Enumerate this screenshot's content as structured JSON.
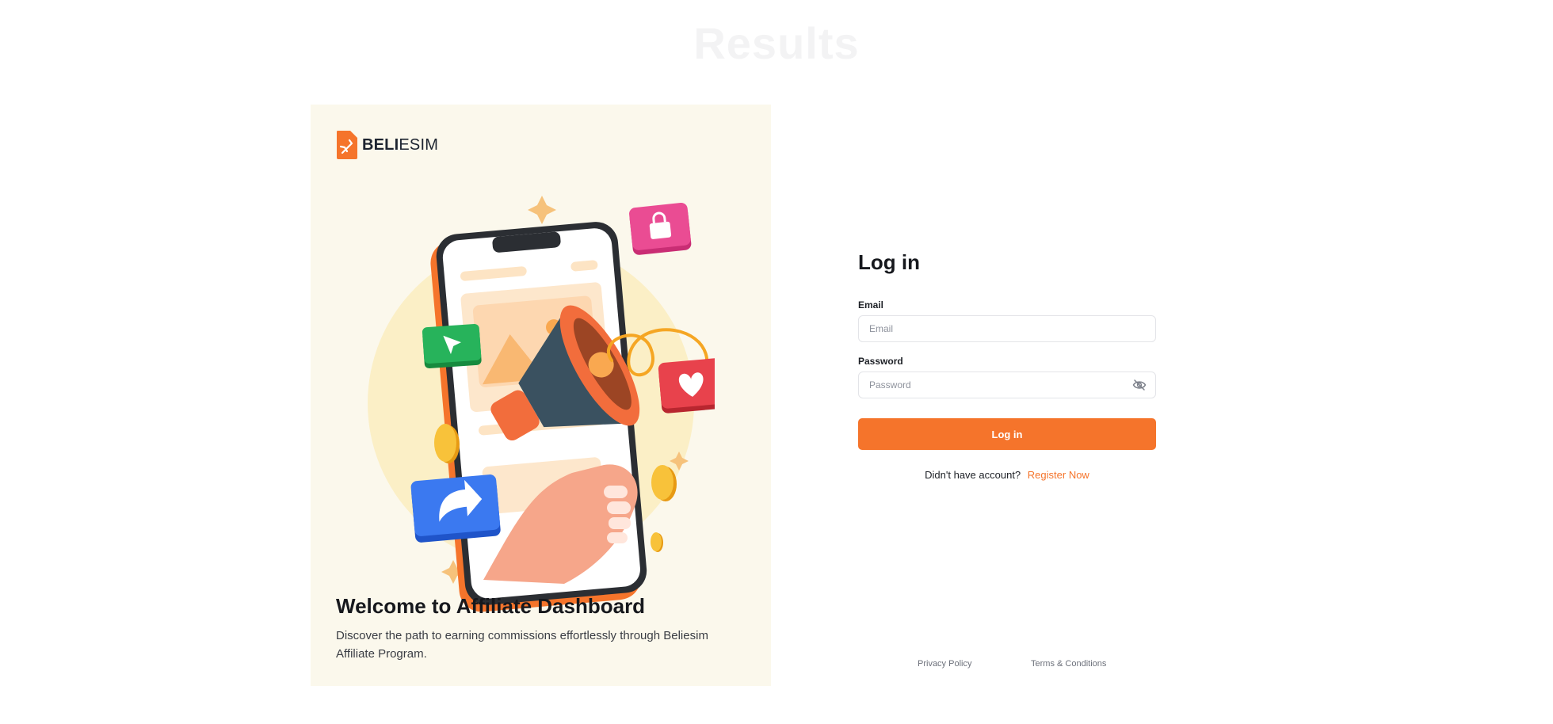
{
  "background_heading": "Results",
  "brand": {
    "name_bold": "BELI",
    "name_regular": "ESIM",
    "accent_color": "#f5742b"
  },
  "promo": {
    "illustration_icon": "megaphone-phone-illustration",
    "title": "Welcome to Affiliate Dashboard",
    "description": "Discover the path to earning commissions effortlessly through Beliesim Affiliate Program."
  },
  "login": {
    "title": "Log in",
    "email_label": "Email",
    "email_placeholder": "Email",
    "email_value": "",
    "password_label": "Password",
    "password_placeholder": "Password",
    "password_value": "",
    "password_toggle_icon": "eye-off-icon",
    "submit_label": "Log in",
    "no_account_text": "Didn't have account?",
    "register_label": "Register Now"
  },
  "footer": {
    "privacy_label": "Privacy Policy",
    "terms_label": "Terms & Conditions"
  }
}
